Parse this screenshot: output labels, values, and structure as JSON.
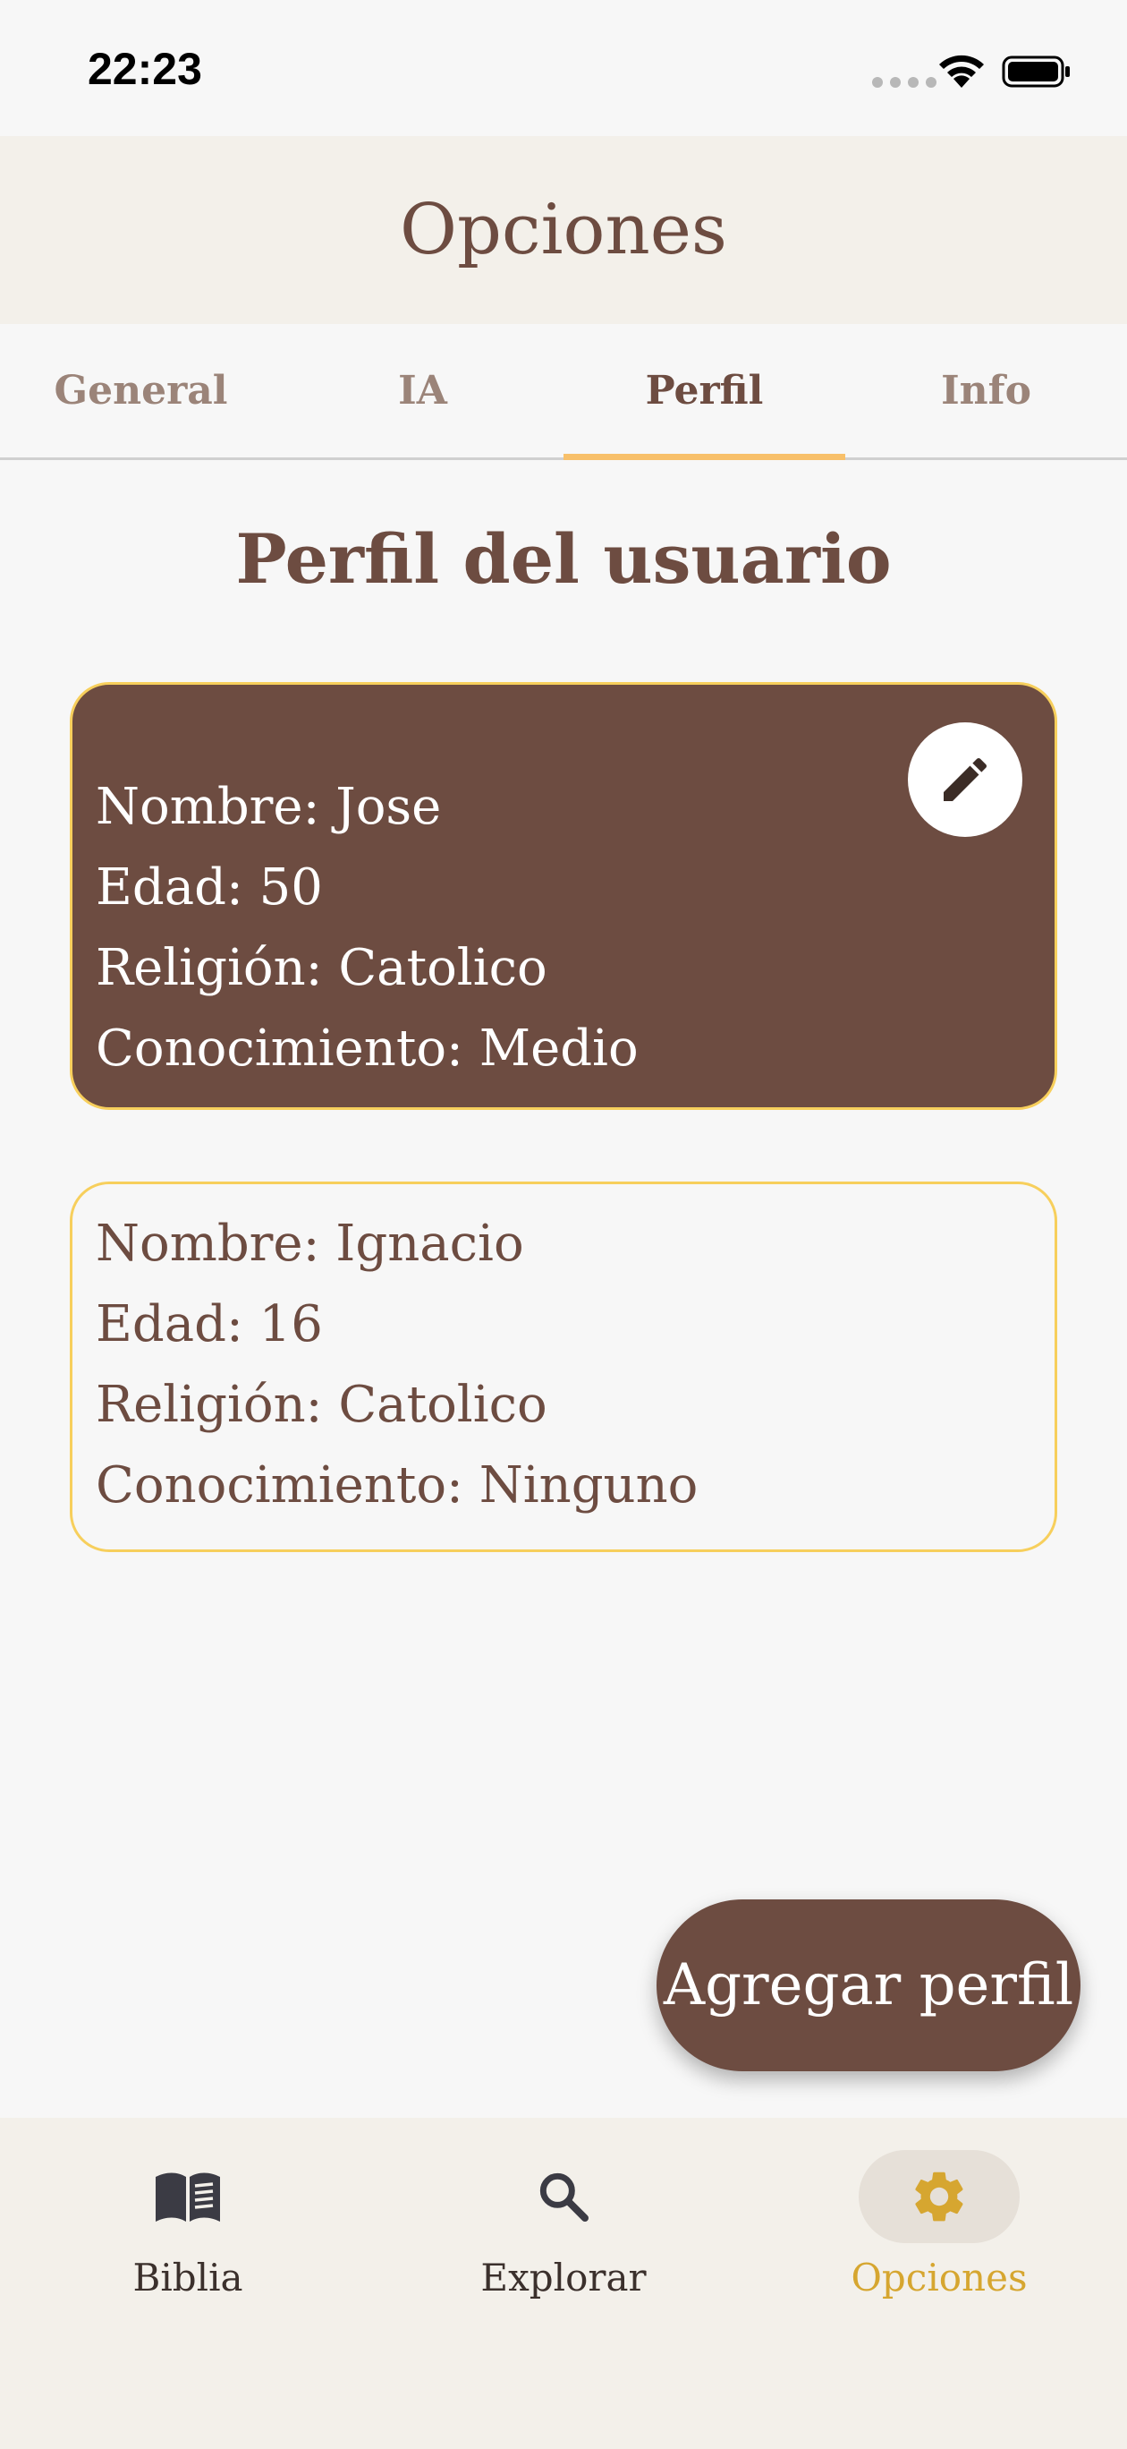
{
  "status_bar": {
    "time": "22:23"
  },
  "app_bar": {
    "title": "Opciones"
  },
  "tabs": [
    {
      "label": "General",
      "active": false
    },
    {
      "label": "IA",
      "active": false
    },
    {
      "label": "Perfil",
      "active": true
    },
    {
      "label": "Info",
      "active": false
    }
  ],
  "section": {
    "title": "Perfil del usuario"
  },
  "profiles": [
    {
      "name": "Nombre: Jose",
      "age": "Edad: 50",
      "religion": "Religión: Catolico",
      "knowledge": "Conocimiento: Medio",
      "selected": true
    },
    {
      "name": "Nombre: Ignacio",
      "age": "Edad: 16",
      "religion": "Religión: Catolico",
      "knowledge": "Conocimiento: Ninguno",
      "selected": false
    }
  ],
  "fab": {
    "label": "Agregar perfil"
  },
  "bottom_nav": [
    {
      "label": "Biblia",
      "icon": "book-icon",
      "active": false
    },
    {
      "label": "Explorar",
      "icon": "search-icon",
      "active": false
    },
    {
      "label": "Opciones",
      "icon": "gear-icon",
      "active": true
    }
  ],
  "colors": {
    "primary_brown": "#6d4c41",
    "accent_gold": "#d6a630",
    "card_border": "#f7cf5c",
    "tab_indicator": "#f8c06a",
    "bar_background": "#f3f0ea"
  }
}
